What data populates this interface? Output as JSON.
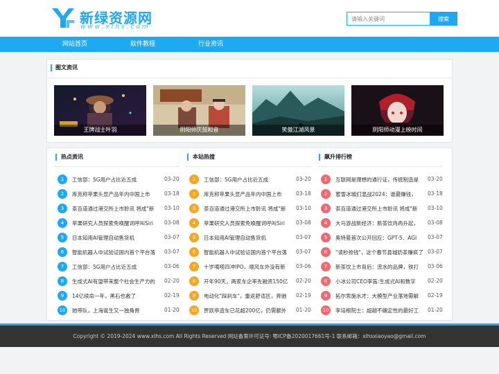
{
  "site": {
    "title": "新绿资源网",
    "subtitle": "www.xlhs.com"
  },
  "search": {
    "placeholder": "请输入关键词",
    "button": "搜索"
  },
  "nav": [
    "网站首页",
    "软件教程",
    "行业资讯"
  ],
  "gallery": {
    "title": "图文资讯",
    "items": [
      {
        "caption": "王牌战士叶羽"
      },
      {
        "caption": "阴阳师庆鼓和音"
      },
      {
        "caption": "笑傲江湖风景"
      },
      {
        "caption": "阴阳师动漫上映时间"
      }
    ]
  },
  "columns": [
    {
      "title": "热点资讯",
      "items": [
        {
          "title": "工信部：5G用户占比近五成",
          "date": "03-20"
        },
        {
          "title": "库克称苹果头显产品年内中国上市",
          "date": "03-18"
        },
        {
          "title": "茶百道通过港交所上市聆讯 将成\"新",
          "date": "03-10"
        },
        {
          "title": "苹果研究人员探索免唤醒词呼叫Siri",
          "date": "03-08"
        },
        {
          "title": "日本知用AI管理自动售货机",
          "date": "03-07"
        },
        {
          "title": "智能机器人中试验证国内首个平台落",
          "date": "03-07"
        },
        {
          "title": "工信部：5G用户占比近五成",
          "date": "03-06"
        },
        {
          "title": "生成式AI有望带来整个社会生产力的",
          "date": "02-20"
        },
        {
          "title": "14亿续命一年，黑石也救了",
          "date": "02-19"
        },
        {
          "title": "她带队，上海诞生又一独角兽",
          "date": "01-20"
        }
      ]
    },
    {
      "title": "本站热搜",
      "items": [
        {
          "title": "工信部：5G用户占比近五成",
          "date": "03-20"
        },
        {
          "title": "库克称苹果头显产品年内中国上市",
          "date": "03-18"
        },
        {
          "title": "茶百道通过港交所上市聆讯 将成\"新",
          "date": "03-10"
        },
        {
          "title": "苹果研究人员探索免唤醒词呼叫Siri",
          "date": "03-08"
        },
        {
          "title": "日本知用AI管理自动售货机",
          "date": "03-07"
        },
        {
          "title": "智能机器人中试验证国内首个平台落",
          "date": "03-07"
        },
        {
          "title": "十岁嘀嗒四冲IPO，顺风车外没有新",
          "date": "03-06"
        },
        {
          "title": "开年90天，两家车企率先融资150亿",
          "date": "02-20"
        },
        {
          "title": "电动化\"踩刹车\"，重返舒适区，奔驰",
          "date": "02-19"
        },
        {
          "title": "贾跃亭造车已花超200亿，仍需额外",
          "date": "01-20"
        }
      ]
    },
    {
      "title": "飙升排行榜",
      "items": [
        {
          "title": "互联网是理想的通行证，传统制造是",
          "date": "03-20"
        },
        {
          "title": "蜜雪冰城们混战2024：谁最赚钱，",
          "date": "03-18"
        },
        {
          "title": "茶百道通过港交所上市聆讯 将成\"新",
          "date": "03-10"
        },
        {
          "title": "大马游战新经济：新茶饮冉冉升起，",
          "date": "03-08"
        },
        {
          "title": "奥特曼首次公开回应：GPT-5、AGI",
          "date": "03-07"
        },
        {
          "title": "\"读秒抢钱\"，这个春节县城奶茶赚疯了",
          "date": "03-07"
        },
        {
          "title": "新茶饮上市背后：流水的品牌，铁打",
          "date": "03-06"
        },
        {
          "title": "小冰公司CEO李笛:生成式AI和数字",
          "date": "02-20"
        },
        {
          "title": "拓尔思施水才：大模型产业落地需解",
          "date": "02-19"
        },
        {
          "title": "李培根院士：超越不确定性的最好工",
          "date": "01-20"
        }
      ]
    }
  ],
  "footer": {
    "text": "Copyright © 2019-2024 www.xlhs.com All Rights Reserved    网站备案许可证号: 鄂ICP备2020017661号-1    联系邮箱：xlhsxiaoyao@gmail.com"
  },
  "colors": {
    "accent": "#1ea9f3",
    "col1_badge": "#1ea9f3",
    "col2_badge": "#f5a623",
    "col3_badge": "#ee6a70"
  }
}
